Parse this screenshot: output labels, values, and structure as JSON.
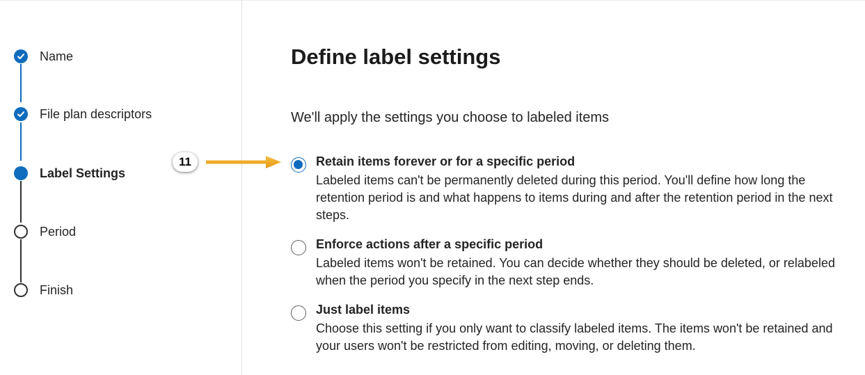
{
  "steps": [
    {
      "label": "Name",
      "status": "completed"
    },
    {
      "label": "File plan descriptors",
      "status": "completed"
    },
    {
      "label": "Label Settings",
      "status": "current"
    },
    {
      "label": "Period",
      "status": "pending"
    },
    {
      "label": "Finish",
      "status": "pending"
    }
  ],
  "page": {
    "title": "Define label settings",
    "subtitle": "We'll apply the settings you choose to labeled items"
  },
  "options": [
    {
      "title": "Retain items forever or for a specific period",
      "description": "Labeled items can't be permanently deleted during this period. You'll define how long the retention period is and what happens to items during and after the retention period in the next steps.",
      "selected": true
    },
    {
      "title": "Enforce actions after a specific period",
      "description": "Labeled items won't be retained. You can decide whether they should be deleted, or relabeled when the period you specify in the next step ends.",
      "selected": false
    },
    {
      "title": "Just label items",
      "description": "Choose this setting if you only want to classify labeled items. The items won't be retained and your users won't be restricted from editing, moving, or deleting them.",
      "selected": false
    }
  ],
  "callout": {
    "number": "11"
  },
  "colors": {
    "accent": "#0f6cbd",
    "callout_arrow": "#f2a516",
    "text": "#242424"
  },
  "icons": {
    "completed_step": "checkmark-circle-icon",
    "current_step": "filled-circle-icon",
    "pending_step": "empty-circle-icon"
  }
}
